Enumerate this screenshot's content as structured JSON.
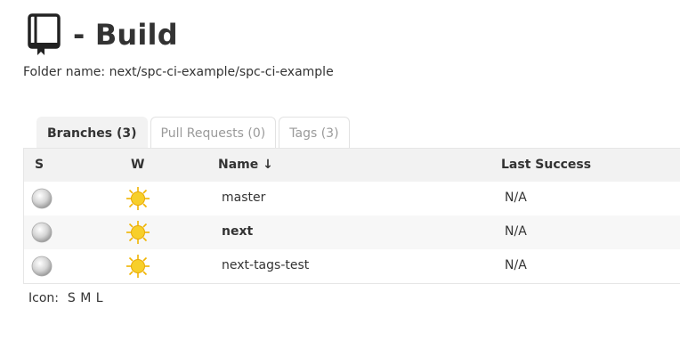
{
  "page": {
    "title": "- Build",
    "folder_name": "Folder name: next/spc-ci-example/spc-ci-example"
  },
  "tabs": [
    {
      "label": "Branches (3)",
      "active": true
    },
    {
      "label": "Pull Requests (0)",
      "active": false
    },
    {
      "label": "Tags (3)",
      "active": false
    }
  ],
  "table": {
    "headers": {
      "status": "S",
      "weather": "W",
      "name": "Name  ↓",
      "last_success": "Last Success"
    },
    "rows": [
      {
        "name": "master",
        "last_success": "N/A",
        "status_icon": "grey-ball-icon",
        "weather_icon": "sunny-icon",
        "bold": false
      },
      {
        "name": "next",
        "last_success": "N/A",
        "status_icon": "grey-ball-icon",
        "weather_icon": "sunny-icon",
        "bold": true
      },
      {
        "name": "next-tags-test",
        "last_success": "N/A",
        "status_icon": "grey-ball-icon",
        "weather_icon": "sunny-icon",
        "bold": false
      }
    ]
  },
  "icon_size": {
    "label": "Icon:",
    "options": [
      "S",
      "M",
      "L"
    ]
  },
  "colors": {
    "header_bg": "#f2f2f2",
    "alt_row_bg": "#f7f7f7",
    "sun": "#f5c518"
  }
}
